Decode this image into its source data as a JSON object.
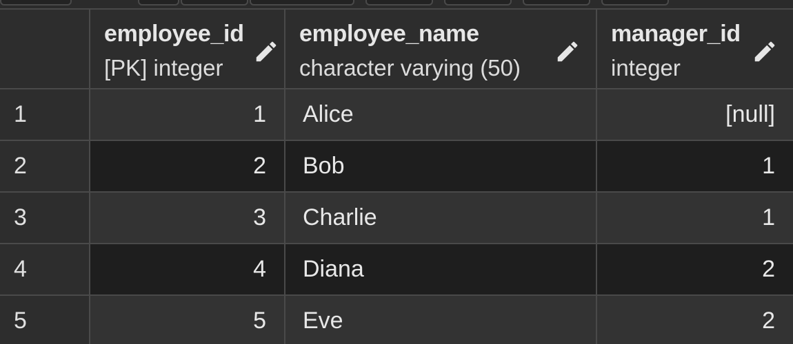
{
  "columns": [
    {
      "name": "employee_id",
      "type": "[PK] integer"
    },
    {
      "name": "employee_name",
      "type": "character varying (50)"
    },
    {
      "name": "manager_id",
      "type": "integer"
    }
  ],
  "rows": [
    {
      "row_number": "1",
      "employee_id": "1",
      "employee_name": "Alice",
      "manager_id": "[null]"
    },
    {
      "row_number": "2",
      "employee_id": "2",
      "employee_name": "Bob",
      "manager_id": "1"
    },
    {
      "row_number": "3",
      "employee_id": "3",
      "employee_name": "Charlie",
      "manager_id": "1"
    },
    {
      "row_number": "4",
      "employee_id": "4",
      "employee_name": "Diana",
      "manager_id": "2"
    },
    {
      "row_number": "5",
      "employee_id": "5",
      "employee_name": "Eve",
      "manager_id": "2"
    }
  ],
  "icons": {
    "column_edit": "pencil-icon"
  },
  "colors": {
    "grid_line": "#4a4a4a",
    "row_odd": "#333333",
    "row_even": "#1e1e1e",
    "text": "#e8e8e8"
  }
}
